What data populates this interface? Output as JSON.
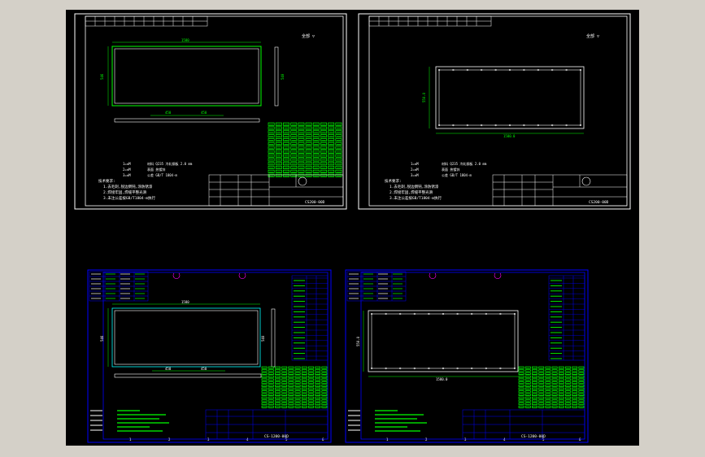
{
  "colors": {
    "background": "#000000",
    "frame_white": "#ffffff",
    "geometry_green": "#00ff00",
    "title_blue": "#0000ff",
    "text_magenta": "#ff00ff",
    "accent_cyan": "#00ffff",
    "accent_yellow": "#ffff00",
    "accent_red": "#ff0000"
  },
  "sheets": [
    {
      "id": "top-left",
      "frame_color": "#ffffff",
      "dimension_width": "1580",
      "dimension_height": "546",
      "side_dimension": "540",
      "hole_spacing_a": "450",
      "hole_spacing_b": "450",
      "note_labels": [
        "1=±M",
        "2=±M",
        "3=±M"
      ],
      "note_values": [
        "材料 Q235 冷轧钢板 2.0 mm",
        "表面 热镀锌",
        "公差 GB/T 1804-m"
      ],
      "requirements_title": "技术要求:",
      "requirements": [
        "1.去毛刺,锐边倒钝,涂防锈漆",
        "2.焊接牢固,焊缝平整光滑",
        "3.未注公差按GB/T1804-m执行"
      ],
      "drawing_number": "CS200-00D",
      "roughness": "全部 ▽"
    },
    {
      "id": "top-right",
      "frame_color": "#ffffff",
      "dimension_width": "1580.0",
      "dimension_height": "550.0",
      "note_labels": [
        "1=±M",
        "2=±M",
        "3=±M"
      ],
      "note_values": [
        "材料 Q235 冷轧钢板 2.0 mm",
        "表面 热镀锌",
        "公差 GB/T 1804-m"
      ],
      "requirements_title": "技术要求:",
      "requirements": [
        "1.去毛刺,锐边倒钝,涂防锈漆",
        "2.焊接牢固,焊缝平整光滑",
        "3.未注公差按GB/T1804-m执行"
      ],
      "drawing_number": "CS200-00D",
      "roughness": "全部 ▽"
    },
    {
      "id": "bottom-left",
      "frame_color": "#0000ff",
      "dimension_width": "1580",
      "dimension_height": "546",
      "side_dimension": "540",
      "hole_spacing_a": "450",
      "hole_spacing_b": "450",
      "drawing_number": "CS-1200-00D",
      "grid_numbers": [
        "1",
        "2",
        "3",
        "4",
        "5",
        "6"
      ]
    },
    {
      "id": "bottom-right",
      "frame_color": "#0000ff",
      "dimension_width": "1580.0",
      "dimension_height": "550.0",
      "drawing_number": "CS-1200-00D",
      "grid_numbers": [
        "1",
        "2",
        "3",
        "4",
        "5",
        "6"
      ]
    }
  ]
}
